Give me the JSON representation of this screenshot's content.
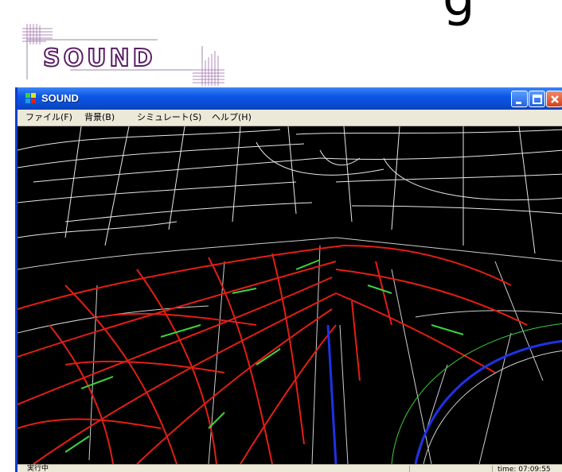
{
  "slide": {
    "title_fragment": "g"
  },
  "logo": {
    "text": "SOUND"
  },
  "window": {
    "title": "SOUND",
    "menu": [
      "ファイル(F)",
      "背景(B)",
      "シミュレート(S)",
      "ヘルプ(H)"
    ]
  },
  "status": {
    "left": "実行中",
    "time": "time: 07:09:55"
  },
  "colors": {
    "title_bar": "#0d55e6",
    "road_network": "#ffffff",
    "congestion_red": "#e41e14",
    "flow_green": "#3cd23c",
    "flow_blue": "#1e32e6"
  },
  "icons": [
    "app-icon",
    "minimize-icon",
    "maximize-icon",
    "close-icon"
  ]
}
